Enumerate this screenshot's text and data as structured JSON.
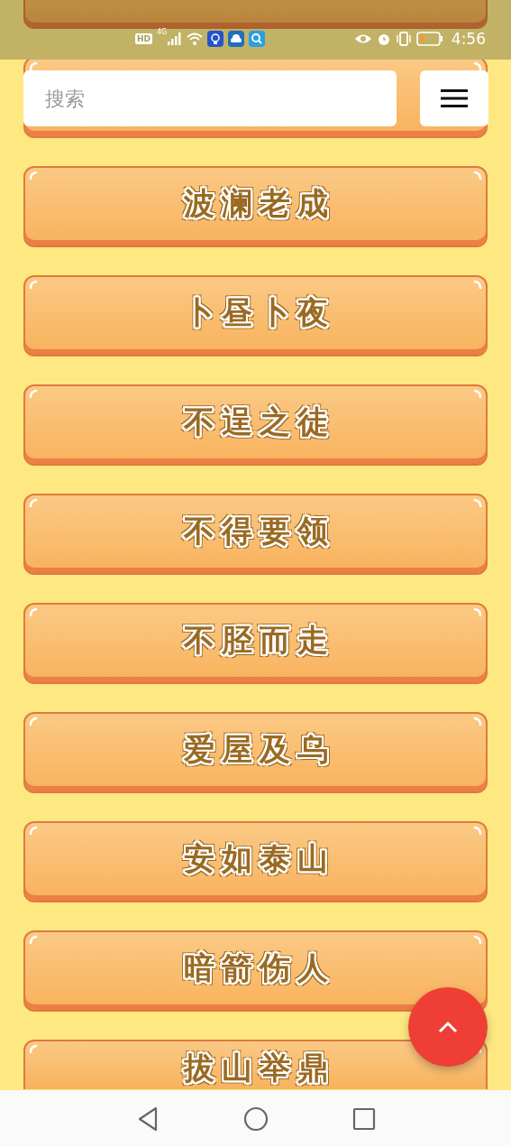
{
  "status_bar": {
    "indicators": [
      "HD",
      "4G"
    ],
    "time": "4:56"
  },
  "search": {
    "placeholder": "搜索"
  },
  "idioms": [
    {
      "kind": "under_status"
    },
    {
      "kind": "under_search"
    },
    {
      "kind": "card",
      "label": "波澜老成"
    },
    {
      "kind": "card",
      "label": "卜昼卜夜"
    },
    {
      "kind": "card",
      "label": "不逞之徒"
    },
    {
      "kind": "card",
      "label": "不得要领"
    },
    {
      "kind": "card",
      "label": "不胫而走"
    },
    {
      "kind": "card",
      "label": "爱屋及乌"
    },
    {
      "kind": "card",
      "label": "安如泰山"
    },
    {
      "kind": "card",
      "label": "暗箭伤人"
    },
    {
      "kind": "cut",
      "label": "拔山举鼎"
    }
  ]
}
